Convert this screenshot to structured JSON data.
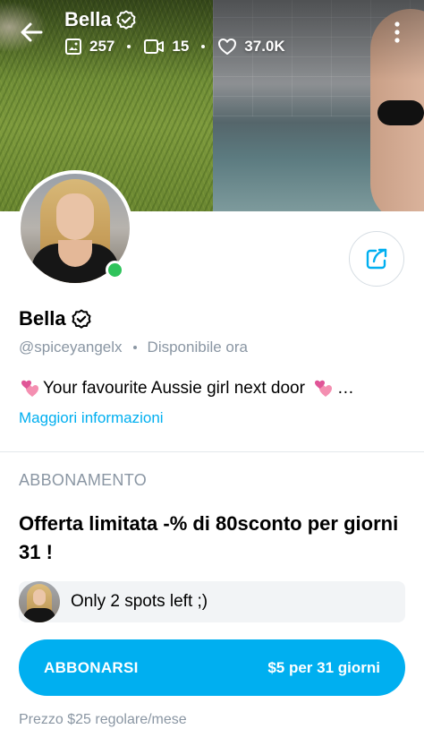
{
  "header": {
    "name": "Bella",
    "photos_count": "257",
    "videos_count": "15",
    "likes_count": "37.0K"
  },
  "profile": {
    "name": "Bella",
    "handle": "@spiceyangelx",
    "status": "Disponibile ora",
    "bio": "Your favourite Aussie girl next door",
    "bio_ellipsis": "…",
    "more_info_label": "Maggiori informazioni",
    "online": true
  },
  "subscription": {
    "heading": "ABBONAMENTO",
    "offer_text": "Offerta limitata -% di 80sconto per giorni 31 !",
    "spots_text": "Only 2 spots left ;)",
    "subscribe_label": "ABBONARSI",
    "subscribe_price": "$5 per 31 giorni",
    "regular_price": "Prezzo $25 regolare/mese"
  },
  "icons": {
    "back": "arrow-left-icon",
    "verified": "verified-badge-icon",
    "photos": "image-icon",
    "videos": "video-icon",
    "likes": "heart-icon",
    "more": "more-vertical-icon",
    "share": "share-icon",
    "bio_emoji": "two-hearts-emoji"
  },
  "colors": {
    "accent": "#00aff0",
    "online": "#2fc35b",
    "muted_text": "#8a96a3"
  }
}
